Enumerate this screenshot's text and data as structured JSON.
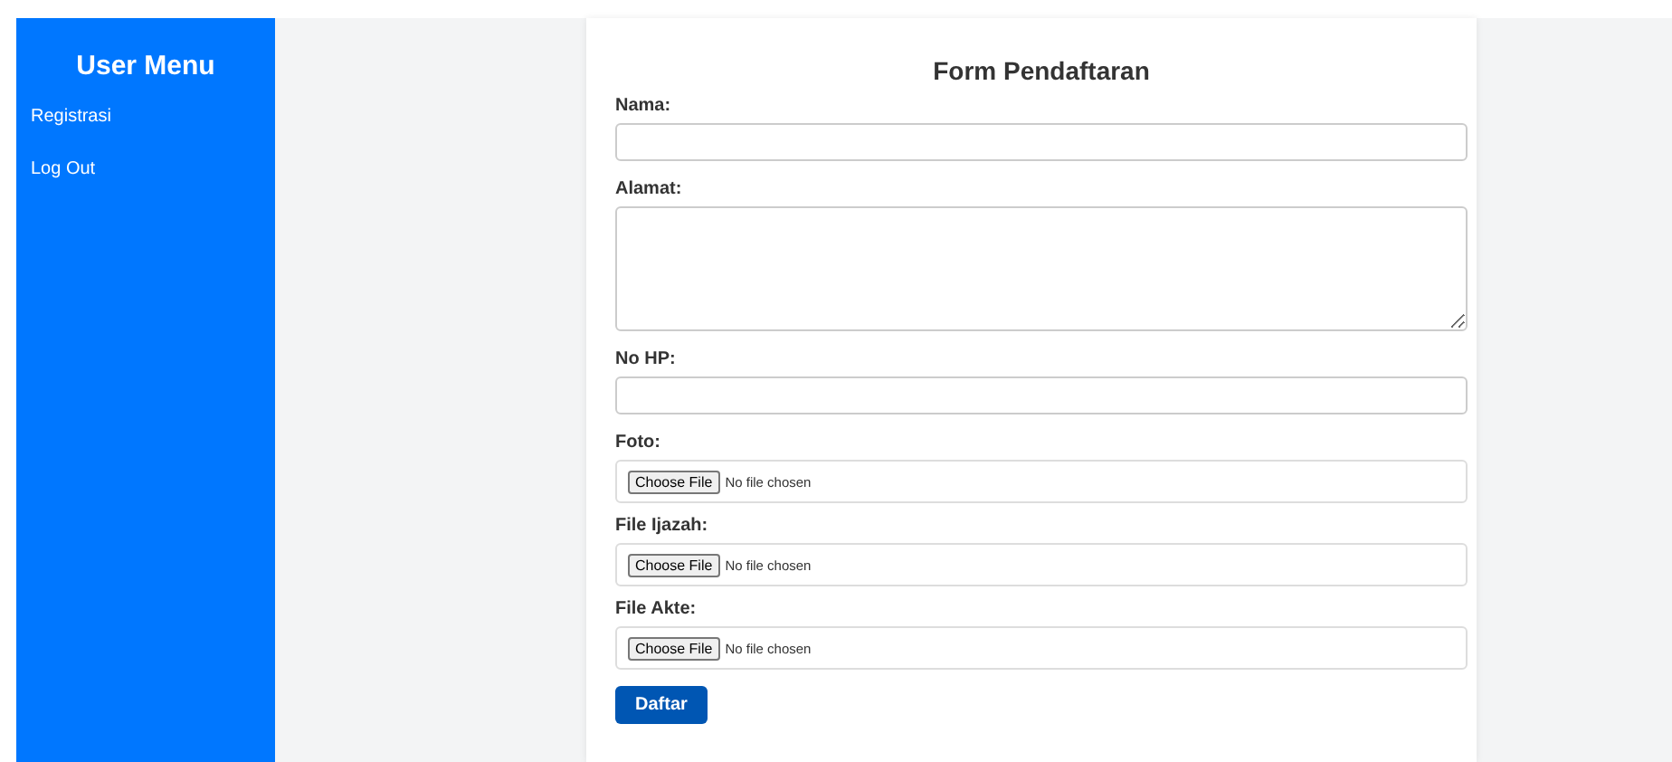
{
  "sidebar": {
    "title": "User Menu",
    "items": [
      {
        "label": "Registrasi"
      },
      {
        "label": "Log Out"
      }
    ]
  },
  "form": {
    "title": "Form Pendaftaran",
    "fields": [
      {
        "kind": "text",
        "label": "Nama:"
      },
      {
        "kind": "textarea",
        "label": "Alamat:"
      },
      {
        "kind": "text",
        "label": "No HP:"
      },
      {
        "kind": "file",
        "label": "Foto:",
        "button": "Choose File",
        "status": "No file chosen"
      },
      {
        "kind": "file",
        "label": "File Ijazah:",
        "button": "Choose File",
        "status": "No file chosen"
      },
      {
        "kind": "file",
        "label": "File Akte:",
        "button": "Choose File",
        "status": "No file chosen"
      }
    ],
    "submit": "Daftar"
  }
}
